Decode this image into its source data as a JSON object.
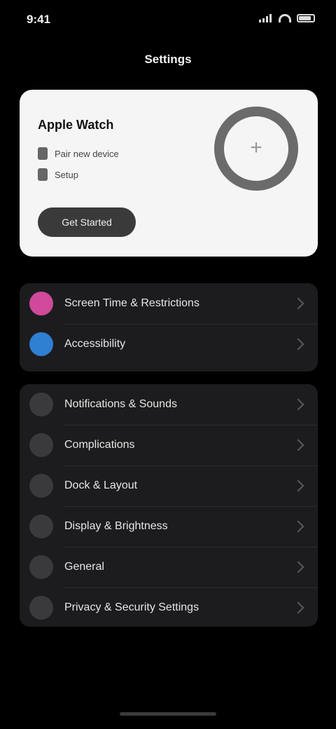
{
  "status_bar": {
    "time": "9:41"
  },
  "nav": {
    "title": "Settings",
    "action": ""
  },
  "hero": {
    "title": "Apple Watch",
    "row1": "Pair new device",
    "row2": "Setup",
    "cta": "Get Started"
  },
  "group1": {
    "items": [
      {
        "label": "Screen Time & Restrictions",
        "icon": "hourglass-icon",
        "color": "#d0499a"
      },
      {
        "label": "Accessibility",
        "icon": "accessibility-icon",
        "color": "#2f7fd3"
      }
    ]
  },
  "group2": {
    "items": [
      {
        "label": "Notifications & Sounds",
        "icon": "bell-icon",
        "value": ""
      },
      {
        "label": "Complications",
        "icon": "grid-icon",
        "value": ""
      },
      {
        "label": "Dock & Layout",
        "icon": "dock-icon",
        "value": ""
      },
      {
        "label": "Display & Brightness",
        "icon": "sun-icon",
        "value": ""
      },
      {
        "label": "General",
        "icon": "gear-icon",
        "value": ""
      },
      {
        "label": "Privacy & Security Settings",
        "icon": "hand-icon",
        "value": ""
      }
    ]
  }
}
